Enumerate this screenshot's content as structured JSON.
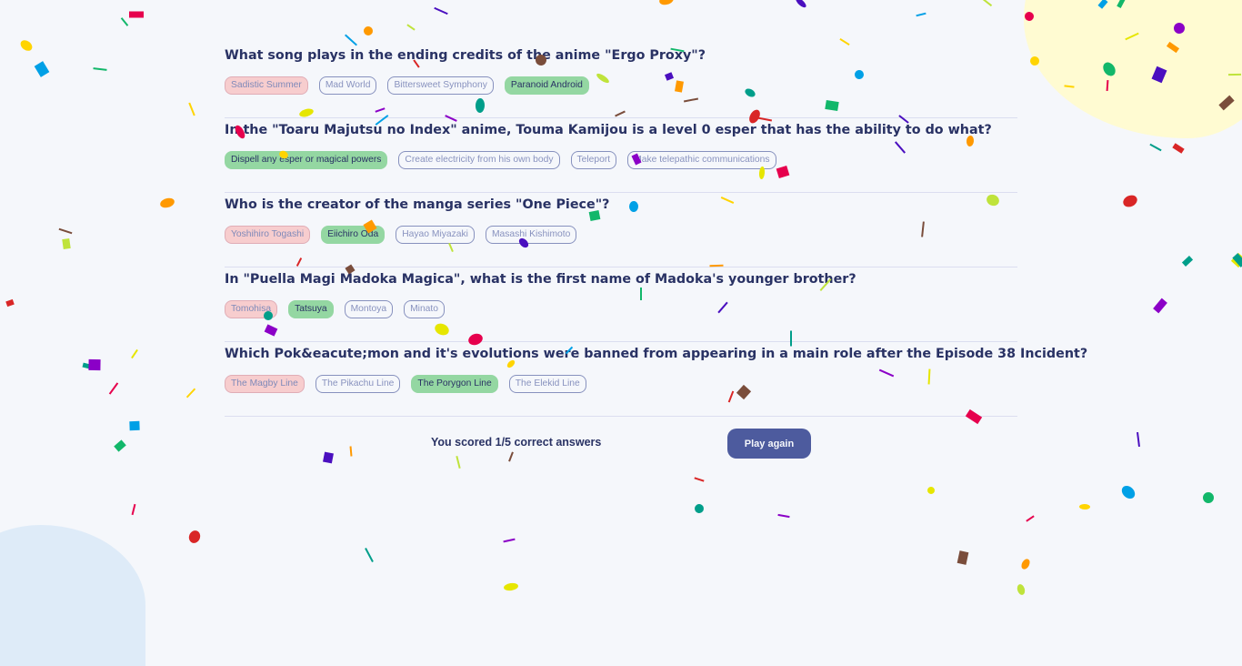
{
  "questions": [
    {
      "text": "What song plays in the ending credits of the anime \"Ergo Proxy\"?",
      "answers": [
        {
          "label": "Sadistic Summer",
          "state": "wrong"
        },
        {
          "label": "Mad World",
          "state": "neutral"
        },
        {
          "label": "Bittersweet Symphony",
          "state": "neutral"
        },
        {
          "label": "Paranoid Android",
          "state": "right"
        }
      ]
    },
    {
      "text": "In the \"Toaru Majutsu no Index\" anime, Touma Kamijou is a level 0 esper that has the ability to do what?",
      "answers": [
        {
          "label": "Dispell any esper or magical powers",
          "state": "right"
        },
        {
          "label": "Create electricity from his own body",
          "state": "neutral"
        },
        {
          "label": "Teleport",
          "state": "neutral"
        },
        {
          "label": "Make telepathic communications",
          "state": "neutral"
        }
      ]
    },
    {
      "text": "Who is the creator of the manga series \"One Piece\"?",
      "answers": [
        {
          "label": "Yoshihiro Togashi",
          "state": "wrong"
        },
        {
          "label": "Eiichiro Oda",
          "state": "right"
        },
        {
          "label": "Hayao Miyazaki",
          "state": "neutral"
        },
        {
          "label": "Masashi Kishimoto",
          "state": "neutral"
        }
      ]
    },
    {
      "text": "In \"Puella Magi Madoka Magica\", what is the first name of Madoka's younger brother?",
      "answers": [
        {
          "label": "Tomohisa",
          "state": "wrong"
        },
        {
          "label": "Tatsuya",
          "state": "right"
        },
        {
          "label": "Montoya",
          "state": "neutral"
        },
        {
          "label": "Minato",
          "state": "neutral"
        }
      ]
    },
    {
      "text": "Which Pok&eacute;mon and it's evolutions were banned from appearing in a main role after the Episode 38 Incident?",
      "answers": [
        {
          "label": "The Magby Line",
          "state": "wrong"
        },
        {
          "label": "The Pikachu Line",
          "state": "neutral"
        },
        {
          "label": "The Porygon Line",
          "state": "right"
        },
        {
          "label": "The Elekid Line",
          "state": "neutral"
        }
      ]
    }
  ],
  "result": {
    "score_text": "You scored 1/5 correct answers",
    "play_again_label": "Play again"
  },
  "colors": {
    "background": "#f5f7fb",
    "primary": "#4d5b9e",
    "heading": "#293264",
    "correct": "#94d7a2",
    "incorrect": "#f8bcbc",
    "confetti": [
      "#e6004d",
      "#ffd400",
      "#00a0e6",
      "#12b76a",
      "#4a0fbf",
      "#ff9900",
      "#bfe33b",
      "#7a4d3b",
      "#d92626",
      "#009e8a",
      "#8b00c7",
      "#e6e600"
    ]
  }
}
